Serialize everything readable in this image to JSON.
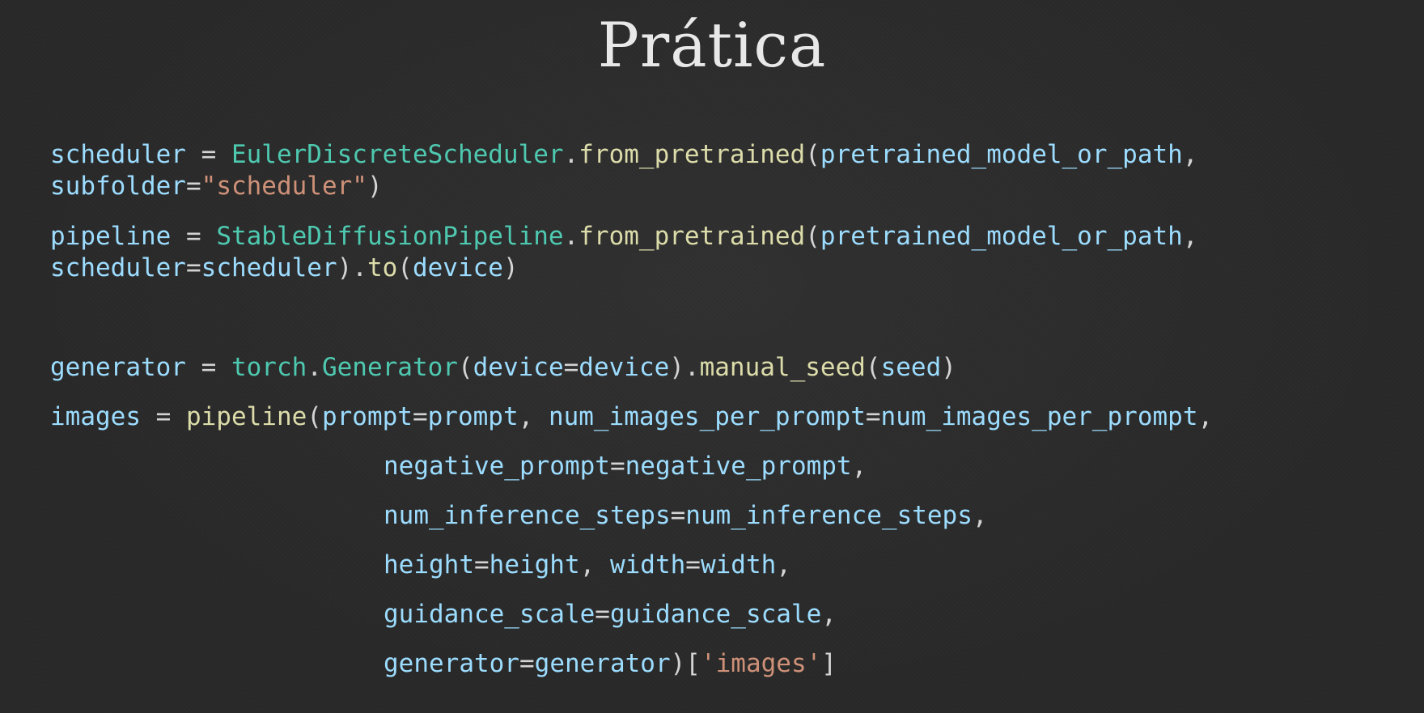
{
  "slide": {
    "title": "Prática"
  },
  "code": {
    "lines": [
      [
        {
          "t": "scheduler",
          "k": "var"
        },
        {
          "t": " = ",
          "k": "pun"
        },
        {
          "t": "EulerDiscreteScheduler",
          "k": "cls"
        },
        {
          "t": ".",
          "k": "pun"
        },
        {
          "t": "from_pretrained",
          "k": "fn"
        },
        {
          "t": "(",
          "k": "pun"
        },
        {
          "t": "pretrained_model_or_path",
          "k": "var"
        },
        {
          "t": ",",
          "k": "pun"
        }
      ],
      [
        {
          "t": "subfolder",
          "k": "var"
        },
        {
          "t": "=",
          "k": "pun"
        },
        {
          "t": "\"scheduler\"",
          "k": "str"
        },
        {
          "t": ")",
          "k": "pun"
        }
      ],
      [
        {
          "t": "pipeline",
          "k": "var"
        },
        {
          "t": " = ",
          "k": "pun"
        },
        {
          "t": "StableDiffusionPipeline",
          "k": "cls"
        },
        {
          "t": ".",
          "k": "pun"
        },
        {
          "t": "from_pretrained",
          "k": "fn"
        },
        {
          "t": "(",
          "k": "pun"
        },
        {
          "t": "pretrained_model_or_path",
          "k": "var"
        },
        {
          "t": ",",
          "k": "pun"
        }
      ],
      [
        {
          "t": "scheduler",
          "k": "var"
        },
        {
          "t": "=",
          "k": "pun"
        },
        {
          "t": "scheduler",
          "k": "var"
        },
        {
          "t": ").",
          "k": "pun"
        },
        {
          "t": "to",
          "k": "fn"
        },
        {
          "t": "(",
          "k": "pun"
        },
        {
          "t": "device",
          "k": "var"
        },
        {
          "t": ")",
          "k": "pun"
        }
      ],
      [
        {
          "t": "generator",
          "k": "var"
        },
        {
          "t": " = ",
          "k": "pun"
        },
        {
          "t": "torch",
          "k": "cls"
        },
        {
          "t": ".",
          "k": "pun"
        },
        {
          "t": "Generator",
          "k": "cls"
        },
        {
          "t": "(",
          "k": "pun"
        },
        {
          "t": "device",
          "k": "var"
        },
        {
          "t": "=",
          "k": "pun"
        },
        {
          "t": "device",
          "k": "var"
        },
        {
          "t": ").",
          "k": "pun"
        },
        {
          "t": "manual_seed",
          "k": "fn"
        },
        {
          "t": "(",
          "k": "pun"
        },
        {
          "t": "seed",
          "k": "var"
        },
        {
          "t": ")",
          "k": "pun"
        }
      ],
      [
        {
          "t": "images",
          "k": "var"
        },
        {
          "t": " = ",
          "k": "pun"
        },
        {
          "t": "pipeline",
          "k": "fn"
        },
        {
          "t": "(",
          "k": "pun"
        },
        {
          "t": "prompt",
          "k": "var"
        },
        {
          "t": "=",
          "k": "pun"
        },
        {
          "t": "prompt",
          "k": "var"
        },
        {
          "t": ", ",
          "k": "pun"
        },
        {
          "t": "num_images_per_prompt",
          "k": "var"
        },
        {
          "t": "=",
          "k": "pun"
        },
        {
          "t": "num_images_per_prompt",
          "k": "var"
        },
        {
          "t": ",",
          "k": "pun"
        }
      ],
      [
        {
          "t": "negative_prompt",
          "k": "var"
        },
        {
          "t": "=",
          "k": "pun"
        },
        {
          "t": "negative_prompt",
          "k": "var"
        },
        {
          "t": ",",
          "k": "pun"
        }
      ],
      [
        {
          "t": "num_inference_steps",
          "k": "var"
        },
        {
          "t": "=",
          "k": "pun"
        },
        {
          "t": "num_inference_steps",
          "k": "var"
        },
        {
          "t": ",",
          "k": "pun"
        }
      ],
      [
        {
          "t": "height",
          "k": "var"
        },
        {
          "t": "=",
          "k": "pun"
        },
        {
          "t": "height",
          "k": "var"
        },
        {
          "t": ", ",
          "k": "pun"
        },
        {
          "t": "width",
          "k": "var"
        },
        {
          "t": "=",
          "k": "pun"
        },
        {
          "t": "width",
          "k": "var"
        },
        {
          "t": ",",
          "k": "pun"
        }
      ],
      [
        {
          "t": "guidance_scale",
          "k": "var"
        },
        {
          "t": "=",
          "k": "pun"
        },
        {
          "t": "guidance_scale",
          "k": "var"
        },
        {
          "t": ",",
          "k": "pun"
        }
      ],
      [
        {
          "t": "generator",
          "k": "var"
        },
        {
          "t": "=",
          "k": "pun"
        },
        {
          "t": "generator",
          "k": "var"
        },
        {
          "t": ")[",
          "k": "pun"
        },
        {
          "t": "'images'",
          "k": "str"
        },
        {
          "t": "]",
          "k": "pun"
        }
      ]
    ]
  },
  "colors": {
    "background": "#282828",
    "title": "#e8e8e8",
    "identifier": "#9cdcfe",
    "class": "#4ec9b0",
    "function": "#dcdcaa",
    "string": "#ce9178",
    "punctuation": "#d4d4d4"
  }
}
